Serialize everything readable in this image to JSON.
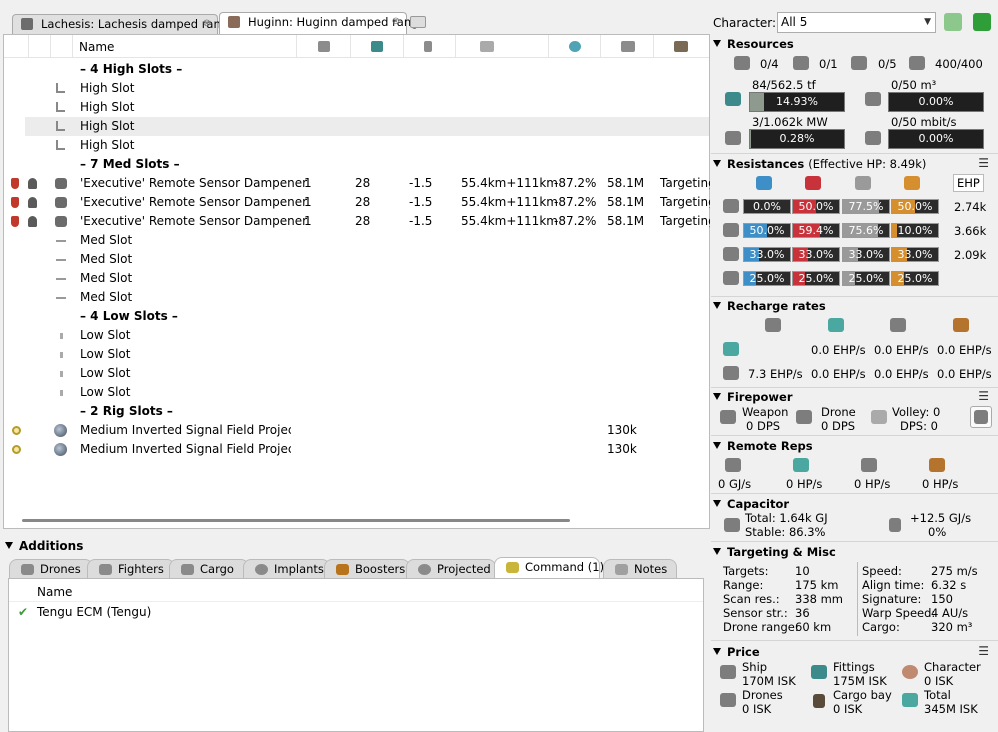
{
  "tabs": [
    {
      "label": "Lachesis: Lachesis damped range",
      "active": false
    },
    {
      "label": "Huginn: Huginn damped range",
      "active": true
    }
  ],
  "fitting": {
    "columns": {
      "name": "Name"
    },
    "rows": [
      {
        "type": "header",
        "name": "– 4 High Slots –"
      },
      {
        "type": "slot",
        "kind": "high",
        "name": "High Slot"
      },
      {
        "type": "slot",
        "kind": "high",
        "name": "High Slot"
      },
      {
        "type": "slot",
        "kind": "high",
        "name": "High Slot",
        "selected": true
      },
      {
        "type": "slot",
        "kind": "high",
        "name": "High Slot"
      },
      {
        "type": "header",
        "name": "– 7 Med Slots –"
      },
      {
        "type": "module",
        "name": "'Executive' Remote Sensor Dampener",
        "c1": "1",
        "c2": "28",
        "c3": "-1.5",
        "c4": "55.4km+111km",
        "c5": "-87.2%",
        "c6": "58.1M",
        "c7": "Targeting"
      },
      {
        "type": "module",
        "name": "'Executive' Remote Sensor Dampener",
        "c1": "1",
        "c2": "28",
        "c3": "-1.5",
        "c4": "55.4km+111km",
        "c5": "-87.2%",
        "c6": "58.1M",
        "c7": "Targeting"
      },
      {
        "type": "module",
        "name": "'Executive' Remote Sensor Dampener",
        "c1": "1",
        "c2": "28",
        "c3": "-1.5",
        "c4": "55.4km+111km",
        "c5": "-87.2%",
        "c6": "58.1M",
        "c7": "Targeting"
      },
      {
        "type": "slot",
        "kind": "med",
        "name": "Med Slot"
      },
      {
        "type": "slot",
        "kind": "med",
        "name": "Med Slot"
      },
      {
        "type": "slot",
        "kind": "med",
        "name": "Med Slot"
      },
      {
        "type": "slot",
        "kind": "med",
        "name": "Med Slot"
      },
      {
        "type": "header",
        "name": "– 4 Low Slots –"
      },
      {
        "type": "slot",
        "kind": "low",
        "name": "Low Slot"
      },
      {
        "type": "slot",
        "kind": "low",
        "name": "Low Slot"
      },
      {
        "type": "slot",
        "kind": "low",
        "name": "Low Slot"
      },
      {
        "type": "slot",
        "kind": "low",
        "name": "Low Slot"
      },
      {
        "type": "header",
        "name": "– 2 Rig Slots –"
      },
      {
        "type": "rig",
        "name": "Medium Inverted Signal Field Projector I",
        "c6": "130k"
      },
      {
        "type": "rig",
        "name": "Medium Inverted Signal Field Projector I",
        "c6": "130k"
      }
    ]
  },
  "additions": {
    "title": "Additions",
    "tabs": [
      {
        "label": "Drones"
      },
      {
        "label": "Fighters"
      },
      {
        "label": "Cargo"
      },
      {
        "label": "Implants"
      },
      {
        "label": "Boosters"
      },
      {
        "label": "Projected"
      },
      {
        "label": "Command (1)",
        "active": true
      },
      {
        "label": "Notes"
      }
    ],
    "name_header": "Name",
    "items": [
      {
        "name": "Tengu ECM (Tengu)",
        "checked": true
      }
    ]
  },
  "right": {
    "character_label": "Character:",
    "character_value": "All 5",
    "resources": {
      "title": "Resources",
      "hardpoints": [
        "0/4",
        "0/1",
        "0/5",
        "400/400"
      ],
      "cpu_label": "84/562.5 tf",
      "cpu_pct": "14.93%",
      "cpu_frac": 0.1493,
      "cargo_label": "0/50 m³",
      "cargo_pct": "0.00%",
      "pg_label": "3/1.062k MW",
      "pg_pct": "0.28%",
      "pg_frac": 0.0028,
      "bw_label": "0/50 mbit/s",
      "bw_pct": "0.00%"
    },
    "resistances": {
      "title": "Resistances",
      "subtitle": "(Effective HP: 8.49k)",
      "ehp_header": "EHP",
      "rows": [
        {
          "vals": [
            "0.0%",
            "50.0%",
            "77.5%",
            "50.0%"
          ],
          "fracs": [
            0.0,
            0.5,
            0.775,
            0.5
          ],
          "ehp": "2.74k"
        },
        {
          "vals": [
            "50.0%",
            "59.4%",
            "75.6%",
            "10.0%"
          ],
          "fracs": [
            0.5,
            0.594,
            0.756,
            0.1
          ],
          "ehp": "3.66k"
        },
        {
          "vals": [
            "33.0%",
            "33.0%",
            "33.0%",
            "33.0%"
          ],
          "fracs": [
            0.33,
            0.33,
            0.33,
            0.33
          ],
          "ehp": "2.09k"
        },
        {
          "vals": [
            "25.0%",
            "25.0%",
            "25.0%",
            "25.0%"
          ],
          "fracs": [
            0.25,
            0.25,
            0.25,
            0.25
          ],
          "ehp": ""
        }
      ],
      "colors": [
        "#3e8fc7",
        "#c8323a",
        "#9a9a9a",
        "#d68f2e"
      ]
    },
    "recharge": {
      "title": "Recharge rates",
      "rows": [
        [
          "0.0 EHP/s",
          "0.0 EHP/s",
          "0.0 EHP/s"
        ],
        [
          "7.3 EHP/s",
          "0.0 EHP/s",
          "0.0 EHP/s",
          "0.0 EHP/s"
        ]
      ]
    },
    "firepower": {
      "title": "Firepower",
      "weapon_label": "Weapon",
      "weapon_dps": "0 DPS",
      "drone_label": "Drone",
      "drone_dps": "0 DPS",
      "volley": "Volley: 0",
      "dps": "DPS: 0"
    },
    "remote_reps": {
      "title": "Remote Reps",
      "values": [
        "0 GJ/s",
        "0 HP/s",
        "0 HP/s",
        "0 HP/s"
      ]
    },
    "capacitor": {
      "title": "Capacitor",
      "total": "Total: 1.64k GJ",
      "stable": "Stable: 86.3%",
      "rate": "+12.5 GJ/s",
      "rate_sub": "0%"
    },
    "targeting": {
      "title": "Targeting & Misc",
      "left": [
        {
          "label": "Targets:",
          "value": "10"
        },
        {
          "label": "Range:",
          "value": "175 km"
        },
        {
          "label": "Scan res.:",
          "value": "338 mm"
        },
        {
          "label": "Sensor str.:",
          "value": "36"
        },
        {
          "label": "Drone range:",
          "value": "60 km"
        }
      ],
      "right": [
        {
          "label": "Speed:",
          "value": "275 m/s"
        },
        {
          "label": "Align time:",
          "value": "6.32 s"
        },
        {
          "label": "Signature:",
          "value": "150"
        },
        {
          "label": "Warp Speed:",
          "value": "4 AU/s"
        },
        {
          "label": "Cargo:",
          "value": "320 m³"
        }
      ]
    },
    "price": {
      "title": "Price",
      "items": [
        {
          "label": "Ship",
          "value": "170M ISK"
        },
        {
          "label": "Fittings",
          "value": "175M ISK"
        },
        {
          "label": "Character",
          "value": "0 ISK"
        },
        {
          "label": "Drones",
          "value": "0 ISK"
        },
        {
          "label": "Cargo bay",
          "value": "0 ISK"
        },
        {
          "label": "Total",
          "value": "345M ISK"
        }
      ]
    }
  }
}
